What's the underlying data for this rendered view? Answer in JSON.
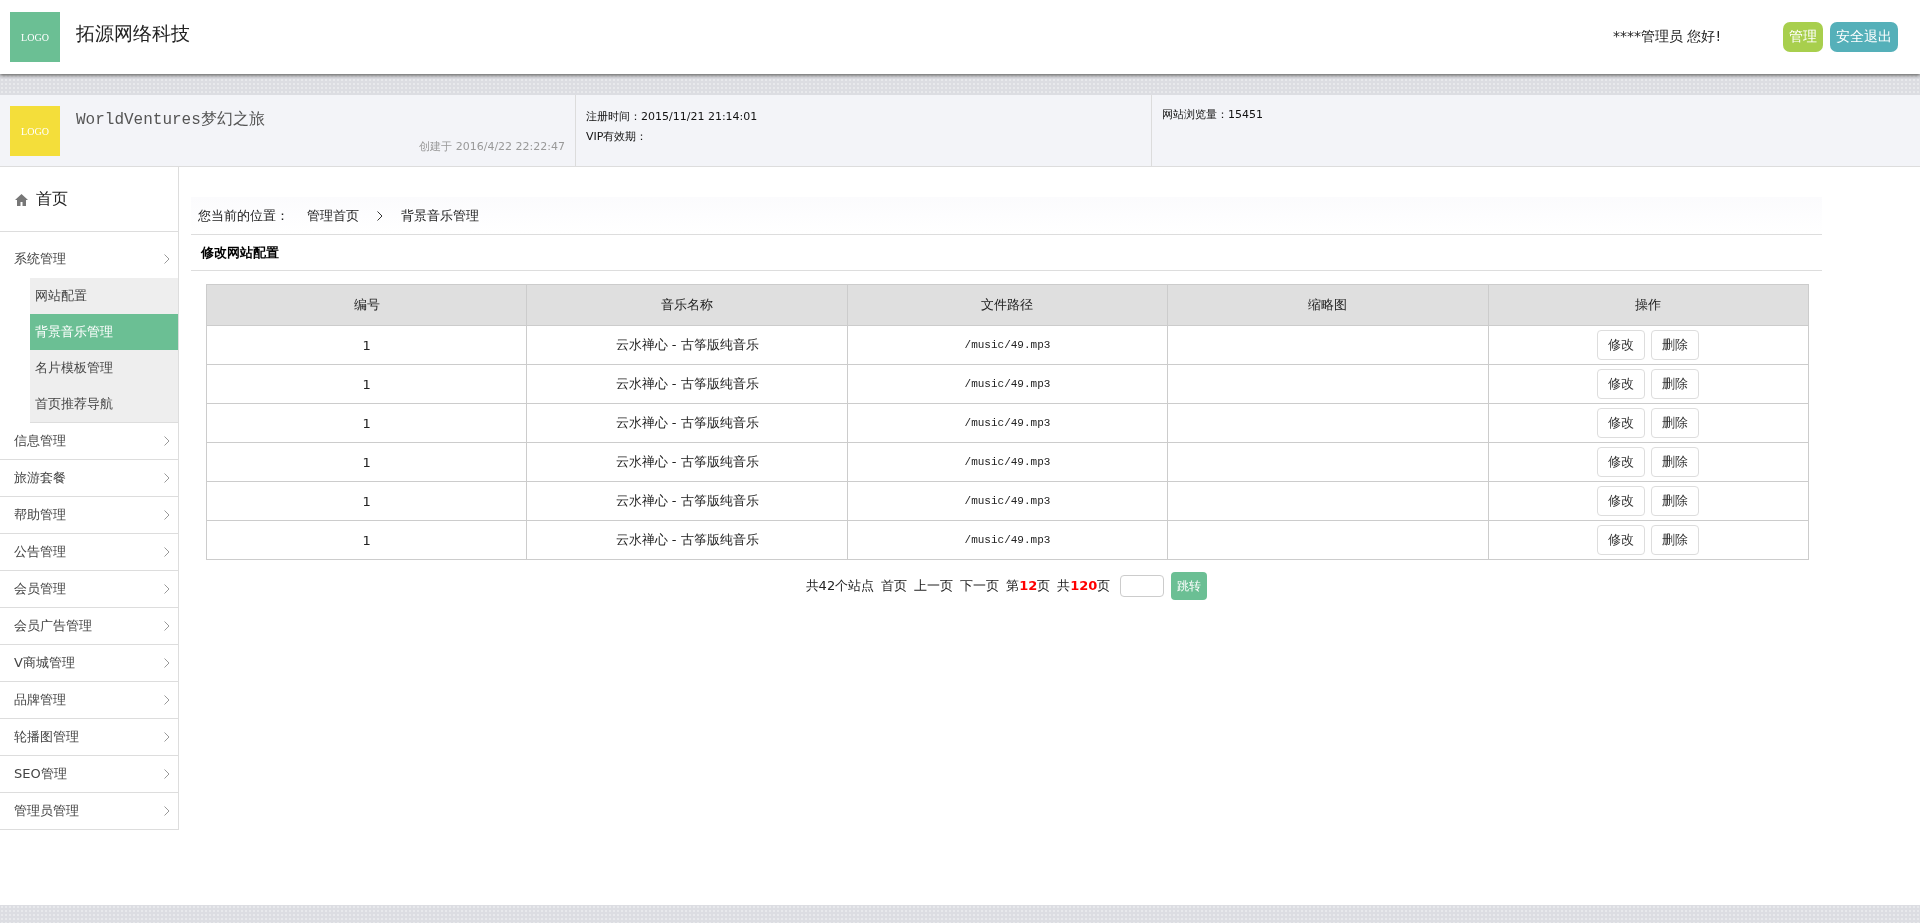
{
  "header": {
    "logo": "LOGO",
    "title": "拓源网络科技",
    "greeting": "****管理员 您好!",
    "buttons": [
      {
        "label": "管理",
        "kind": "manage"
      },
      {
        "label": "安全退出",
        "kind": "logout"
      }
    ]
  },
  "site": {
    "logo": "LOGO",
    "name": "WorldVentures梦幻之旅",
    "created": "创建于 2016/4/22 22:22:47",
    "registered": "注册时间：2015/11/21 21:14:01",
    "vip": "VIP有效期：",
    "visits": "网站浏览量：15451"
  },
  "sidebar": {
    "home": "首页",
    "items": [
      {
        "label": "系统管理",
        "selected": false,
        "expanded": true,
        "children": [
          {
            "label": "网站配置",
            "selected": false
          },
          {
            "label": "背景音乐管理",
            "selected": true
          },
          {
            "label": "名片模板管理",
            "selected": false
          },
          {
            "label": "首页推荐导航",
            "selected": false
          }
        ]
      },
      {
        "label": "信息管理",
        "selected": false
      },
      {
        "label": "旅游套餐",
        "selected": false
      },
      {
        "label": "帮助管理",
        "selected": false
      },
      {
        "label": "公告管理",
        "selected": false
      },
      {
        "label": "会员管理",
        "selected": false
      },
      {
        "label": "会员广告管理",
        "selected": false
      },
      {
        "label": "V商城管理",
        "selected": false
      },
      {
        "label": "品牌管理",
        "selected": false
      },
      {
        "label": "轮播图管理",
        "selected": false
      },
      {
        "label": "SEO管理",
        "selected": false
      },
      {
        "label": "管理员管理",
        "selected": false
      }
    ]
  },
  "breadcrumb": {
    "prefix": "您当前的位置：",
    "items": [
      "管理首页",
      "背景音乐管理"
    ]
  },
  "section_title": "修改网站配置",
  "table": {
    "columns": [
      "编号",
      "音乐名称",
      "文件路径",
      "缩略图",
      "操作"
    ],
    "rows": [
      {
        "id": "1",
        "name": "云水禅心 - 古筝版纯音乐",
        "path": "/music/49.mp3",
        "actions": [
          "修改",
          "删除"
        ]
      },
      {
        "id": "1",
        "name": "云水禅心 - 古筝版纯音乐",
        "path": "/music/49.mp3",
        "actions": [
          "修改",
          "删除"
        ]
      },
      {
        "id": "1",
        "name": "云水禅心 - 古筝版纯音乐",
        "path": "/music/49.mp3",
        "actions": [
          "修改",
          "删除"
        ]
      },
      {
        "id": "1",
        "name": "云水禅心 - 古筝版纯音乐",
        "path": "/music/49.mp3",
        "actions": [
          "修改",
          "删除"
        ]
      },
      {
        "id": "1",
        "name": "云水禅心 - 古筝版纯音乐",
        "path": "/music/49.mp3",
        "actions": [
          "修改",
          "删除"
        ]
      },
      {
        "id": "1",
        "name": "云水禅心 - 古筝版纯音乐",
        "path": "/music/49.mp3",
        "actions": [
          "修改",
          "删除"
        ]
      }
    ]
  },
  "pagination": {
    "items": [
      {
        "kind": "text",
        "text": "共42个站点"
      },
      {
        "kind": "link",
        "text": "首页"
      },
      {
        "kind": "link",
        "text": "上一页"
      },
      {
        "kind": "link",
        "text": "下一页"
      },
      {
        "kind": "text",
        "text": "第**12**页"
      },
      {
        "kind": "text",
        "text": "共**120**页"
      }
    ],
    "jump": "跳转"
  }
}
